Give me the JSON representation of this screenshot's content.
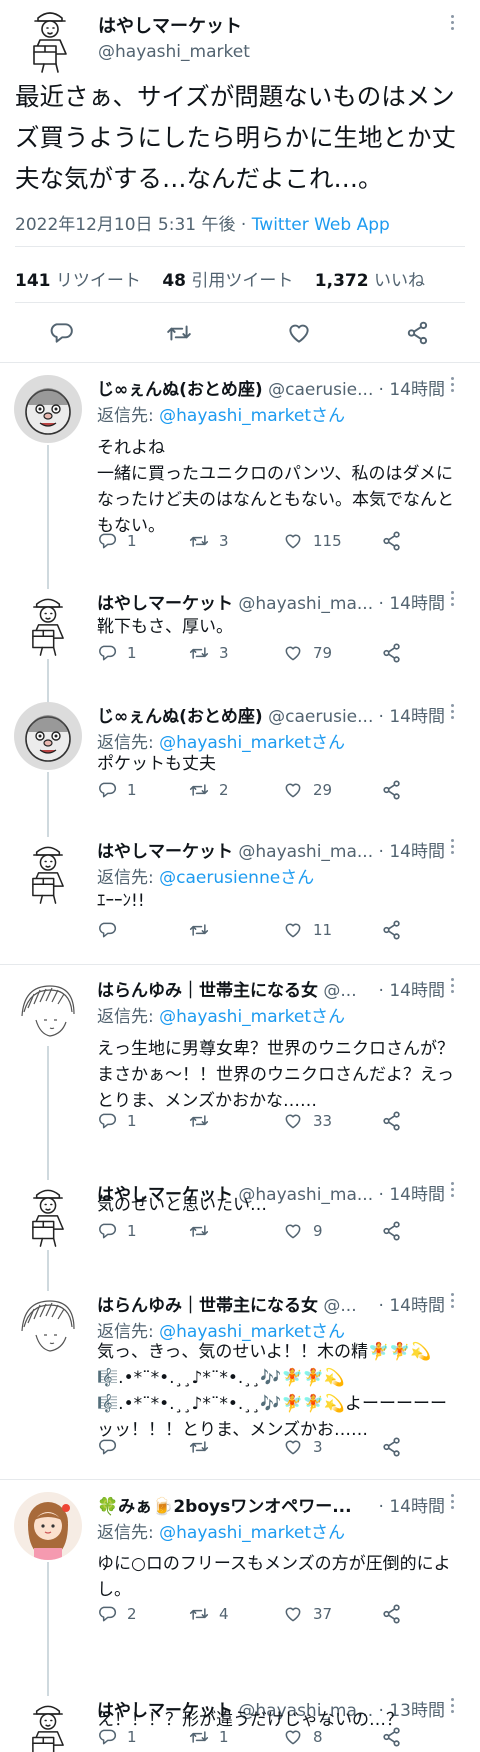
{
  "main": {
    "name": "はやしマーケット",
    "handle": "@hayashi_market",
    "text": "最近さぁ、サイズが問題ないものはメンズ買うようにしたら明らかに生地とか丈夫な気がする…なんだよこれ…。",
    "datetime": "2022年12月10日 5:31 午後",
    "dot": " · ",
    "source": "Twitter Web App",
    "retweets": "141",
    "retweets_label": "リツイート",
    "quotes": "48",
    "quotes_label": "引用ツイート",
    "likes": "1,372",
    "likes_label": "いいね"
  },
  "replies": [
    {
      "name": "じ∞ぇんぬ(おとめ座)",
      "handle": "@caerusie...",
      "time": "· 14時間",
      "reply_prefix": "返信先: ",
      "reply_to": "@hayashi_marketさん",
      "text": "それよね\n一緒に買ったユニクロのパンツ、私のはダメになったけど夫のはなんともない。本気でなんともない。",
      "replies": "1",
      "retweets": "3",
      "likes": "115",
      "avatar": "face"
    },
    {
      "name": "はやしマーケット",
      "handle": "@hayashi_ma...",
      "time": "· 14時間",
      "text": "靴下もさ、厚い。",
      "replies": "1",
      "retweets": "3",
      "likes": "79",
      "avatar": "courier"
    },
    {
      "name": "じ∞ぇんぬ(おとめ座)",
      "handle": "@caerusie...",
      "time": "· 14時間",
      "reply_prefix": "返信先: ",
      "reply_to": "@hayashi_marketさん",
      "text": "ポケットも丈夫",
      "replies": "1",
      "retweets": "2",
      "likes": "29",
      "avatar": "face"
    },
    {
      "name": "はやしマーケット",
      "handle": "@hayashi_ma...",
      "time": "· 14時間",
      "reply_prefix": "返信先: ",
      "reply_to": "@caerusienneさん",
      "text": "ｴｰｰﾝ!!",
      "replies": "",
      "retweets": "",
      "likes": "11",
      "avatar": "courier"
    },
    {
      "name": "はらんゆみ｜世帯主になる女",
      "handle": "@...",
      "time": "· 14時間",
      "reply_prefix": "返信先: ",
      "reply_to": "@hayashi_marketさん",
      "text": "えっ生地に男尊女卑？世界のウニクロさんが？まさかぁ〜！！世界のウニクロさんだよ？えっとりま、メンズかおかな……",
      "replies": "1",
      "retweets": "",
      "likes": "33",
      "avatar": "sketch"
    },
    {
      "name": "はやしマーケット",
      "handle": "@hayashi_ma...",
      "time": "· 14時間",
      "text": "気のせいと思いたい…",
      "replies": "1",
      "retweets": "",
      "likes": "9",
      "avatar": "courier"
    },
    {
      "name": "はらんゆみ｜世帯主になる女",
      "handle": "@...",
      "time": "· 14時間",
      "reply_prefix": "返信先: ",
      "reply_to": "@hayashi_marketさん",
      "text": "気っ、きっ、気のせいよ！！木の精🧚🧚💫🎼.•*¨*•.¸¸♪*¨*•.¸¸🎶🧚🧚💫🎼.•*¨*•.¸¸♪*¨*•.¸¸🎶🧚🧚💫よーーーーーッッ！！！とりま、メンズかお……",
      "replies": "",
      "retweets": "",
      "likes": "3",
      "avatar": "sketch"
    },
    {
      "name": "🍀みぁ🍺2boysワンオペワー...",
      "handle": "",
      "time": "· 14時間",
      "reply_prefix": "返信先: ",
      "reply_to": "@hayashi_marketさん",
      "text": "ゆに○ロのフリースもメンズの方が圧倒的によし。",
      "replies": "2",
      "retweets": "4",
      "likes": "37",
      "avatar": "girl"
    },
    {
      "name": "はやしマーケット",
      "handle": "@hayashi_ma...",
      "time": "· 13時間",
      "text": "え！！！？形が違うだけじゃないの…？",
      "replies": "1",
      "retweets": "1",
      "likes": "8",
      "avatar": "courier"
    }
  ],
  "colors": {
    "accent": "#1d9bf0",
    "muted": "#536471",
    "text": "#0f1419",
    "divider": "#e6e9ec"
  }
}
